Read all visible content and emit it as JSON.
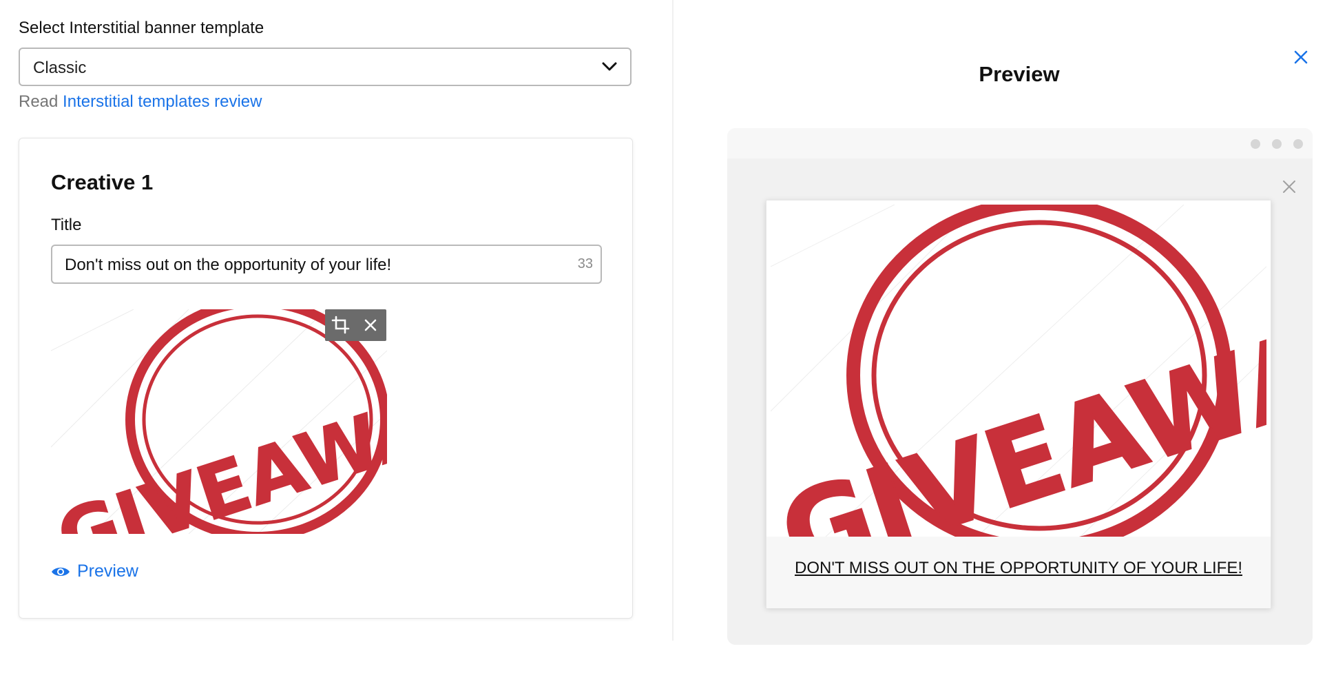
{
  "template_select": {
    "label": "Select Interstitial banner template",
    "value": "Classic"
  },
  "read_row": {
    "prefix": "Read",
    "link_text": "Interstitial templates review"
  },
  "creative": {
    "heading": "Creative 1",
    "title_label": "Title",
    "title_value": "Don't miss out on the opportunity of your life!",
    "char_count": "33",
    "image_text": "GIVEAWAY",
    "preview_link": "Preview"
  },
  "preview_panel": {
    "heading": "Preview",
    "ad_image_text": "GIVEAWAY",
    "ad_caption": "DON'T MISS OUT ON THE OPPORTUNITY OF YOUR LIFE!"
  },
  "colors": {
    "accent": "#1a73e8",
    "stamp_red": "#c8303a",
    "toolbar_gray": "#6b6b6b"
  },
  "icons": [
    "chevron-down-icon",
    "crop-icon",
    "close-icon",
    "eye-icon"
  ]
}
